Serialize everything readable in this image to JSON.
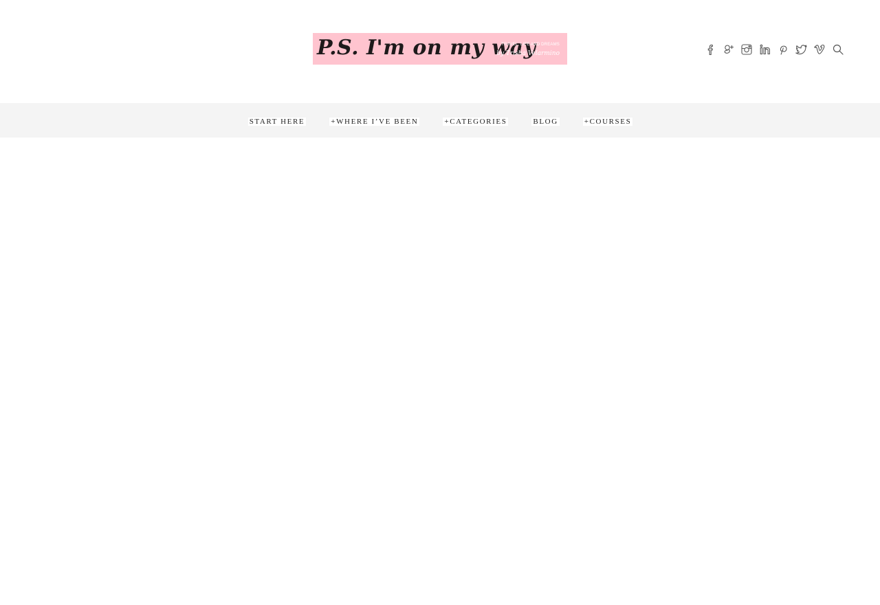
{
  "header": {
    "logo": {
      "title": "P.S. I'm on my way",
      "tagline": "TRAVEL, LIFE AND DREAMS",
      "byline": "by Trisha Velarmino"
    },
    "social_icons": [
      {
        "name": "facebook-icon"
      },
      {
        "name": "google-plus-icon"
      },
      {
        "name": "instagram-icon"
      },
      {
        "name": "linkedin-icon"
      },
      {
        "name": "pinterest-icon"
      },
      {
        "name": "twitter-icon"
      },
      {
        "name": "vimeo-icon"
      },
      {
        "name": "search-icon"
      }
    ]
  },
  "nav": {
    "items": [
      {
        "label": "START HERE"
      },
      {
        "label": "+WHERE I’VE BEEN"
      },
      {
        "label": "+CATEGORIES"
      },
      {
        "label": "BLOG"
      },
      {
        "label": "+COURSES"
      }
    ]
  },
  "colors": {
    "logo_background": "#ffc4cf",
    "nav_background": "#f4f4f4",
    "text": "#222222",
    "icon_stroke": "#555555"
  }
}
